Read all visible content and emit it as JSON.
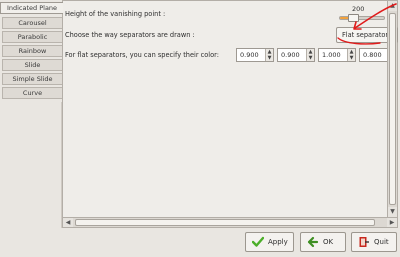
{
  "sidebar": {
    "items": [
      {
        "label": "Indicated Plane",
        "active": true
      },
      {
        "label": "Carousel",
        "active": false
      },
      {
        "label": "Parabolic",
        "active": false
      },
      {
        "label": "Rainbow",
        "active": false
      },
      {
        "label": "Slide",
        "active": false
      },
      {
        "label": "Simple Slide",
        "active": false
      },
      {
        "label": "Curve",
        "active": false
      }
    ]
  },
  "main": {
    "vanishing_label": "Height of the vanishing point :",
    "vanishing_value": "200",
    "vanishing_level": 0.3,
    "separator_label": "Choose the way separators are drawn :",
    "separator_combo": "Flat separator",
    "color_label": "For flat separators, you can specify their color:",
    "color_values": [
      "0.900",
      "0.900",
      "1.000",
      "0.800"
    ]
  },
  "buttons": {
    "apply": "Apply",
    "ok": "OK",
    "quit": "Quit"
  },
  "colors": {
    "accent": "#f2a13b",
    "annotation": "#e01b1b",
    "ok_green": "#4caf2a",
    "quit_red": "#c8281e"
  }
}
